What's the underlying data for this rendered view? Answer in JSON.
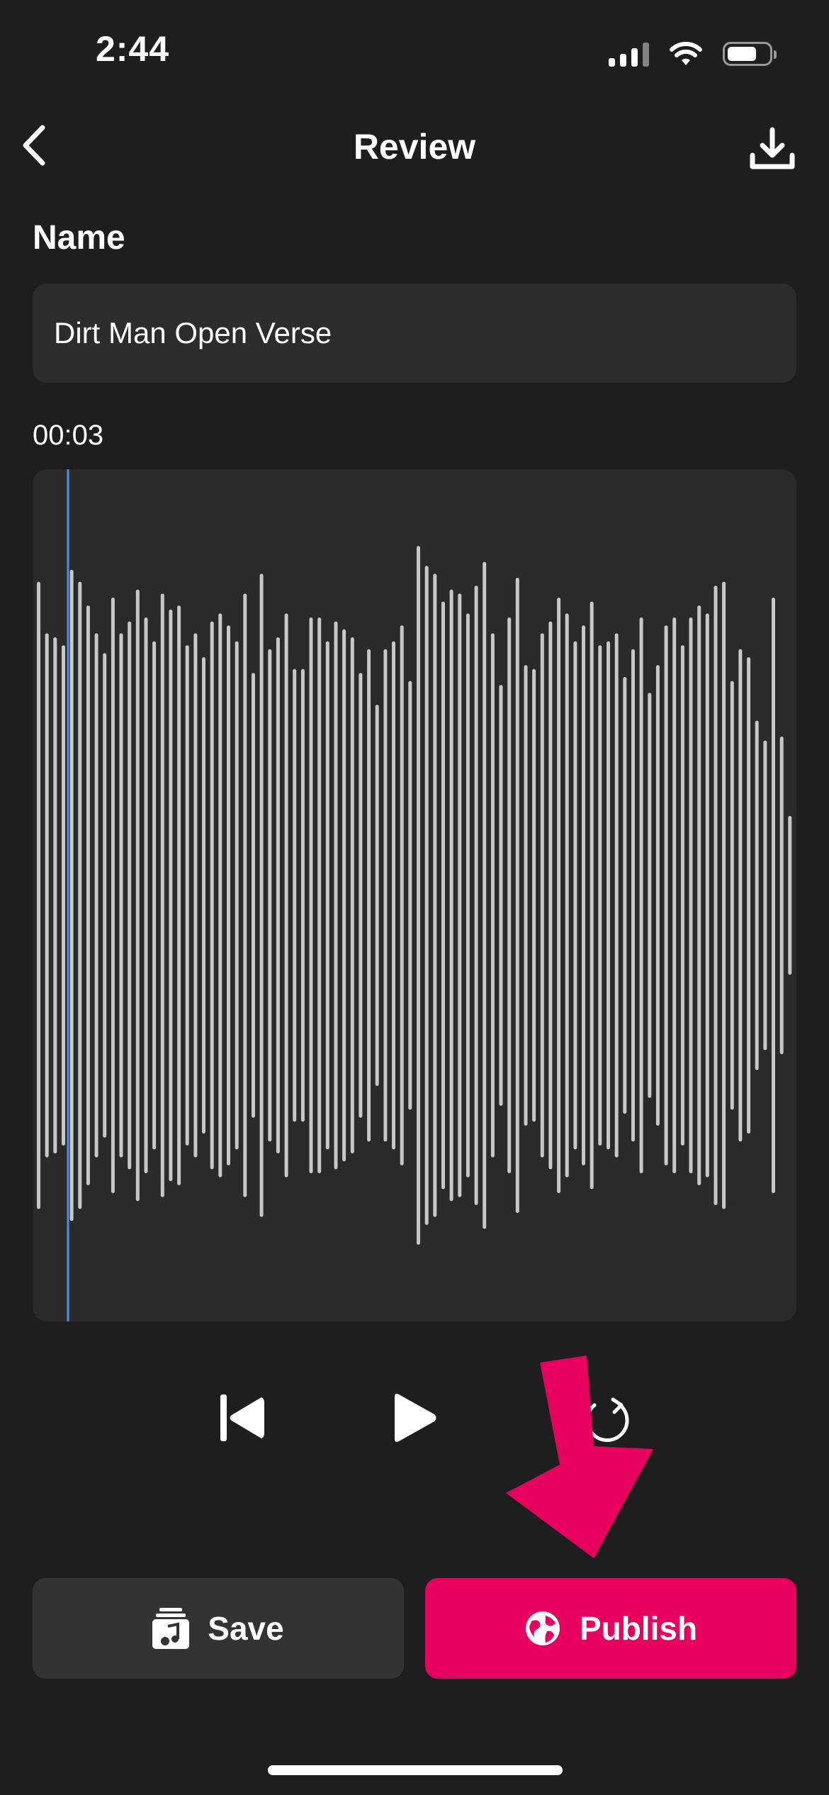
{
  "status_bar": {
    "time": "2:44",
    "icons": [
      "signal-icon",
      "wifi-icon",
      "battery-icon"
    ]
  },
  "header": {
    "title": "Review",
    "back_icon": "chevron-left-icon",
    "download_icon": "download-icon"
  },
  "form": {
    "name_label": "Name",
    "name_value": "Dirt Man Open Verse"
  },
  "player": {
    "elapsed": "00:03",
    "playhead_fraction": 0.045,
    "waveform_amplitudes": [
      0.79,
      0.66,
      0.65,
      0.63,
      0.82,
      0.79,
      0.73,
      0.66,
      0.61,
      0.75,
      0.66,
      0.69,
      0.77,
      0.7,
      0.64,
      0.76,
      0.72,
      0.73,
      0.63,
      0.66,
      0.6,
      0.69,
      0.71,
      0.68,
      0.64,
      0.76,
      0.56,
      0.81,
      0.62,
      0.65,
      0.71,
      0.57,
      0.57,
      0.7,
      0.7,
      0.64,
      0.69,
      0.67,
      0.65,
      0.56,
      0.62,
      0.48,
      0.62,
      0.64,
      0.68,
      0.54,
      0.88,
      0.83,
      0.81,
      0.74,
      0.77,
      0.76,
      0.71,
      0.78,
      0.84,
      0.66,
      0.53,
      0.7,
      0.8,
      0.58,
      0.57,
      0.66,
      0.69,
      0.75,
      0.71,
      0.64,
      0.68,
      0.74,
      0.63,
      0.64,
      0.66,
      0.55,
      0.62,
      0.7,
      0.51,
      0.58,
      0.68,
      0.7,
      0.63,
      0.7,
      0.73,
      0.71,
      0.78,
      0.79,
      0.54,
      0.62,
      0.6,
      0.44,
      0.39,
      0.75,
      0.4,
      0.2
    ],
    "rewind_icon": "skip-back-icon",
    "play_icon": "play-icon",
    "loop_icon": "loop-icon"
  },
  "actions": {
    "save_label": "Save",
    "save_icon": "music-library-icon",
    "publish_label": "Publish",
    "publish_icon": "globe-icon"
  },
  "colors": {
    "background": "#1e1e1e",
    "panel": "#2a2a2a",
    "accent": "#e8005f",
    "playhead": "#4a90e2",
    "waveform_bar": "#c8c8c8"
  }
}
